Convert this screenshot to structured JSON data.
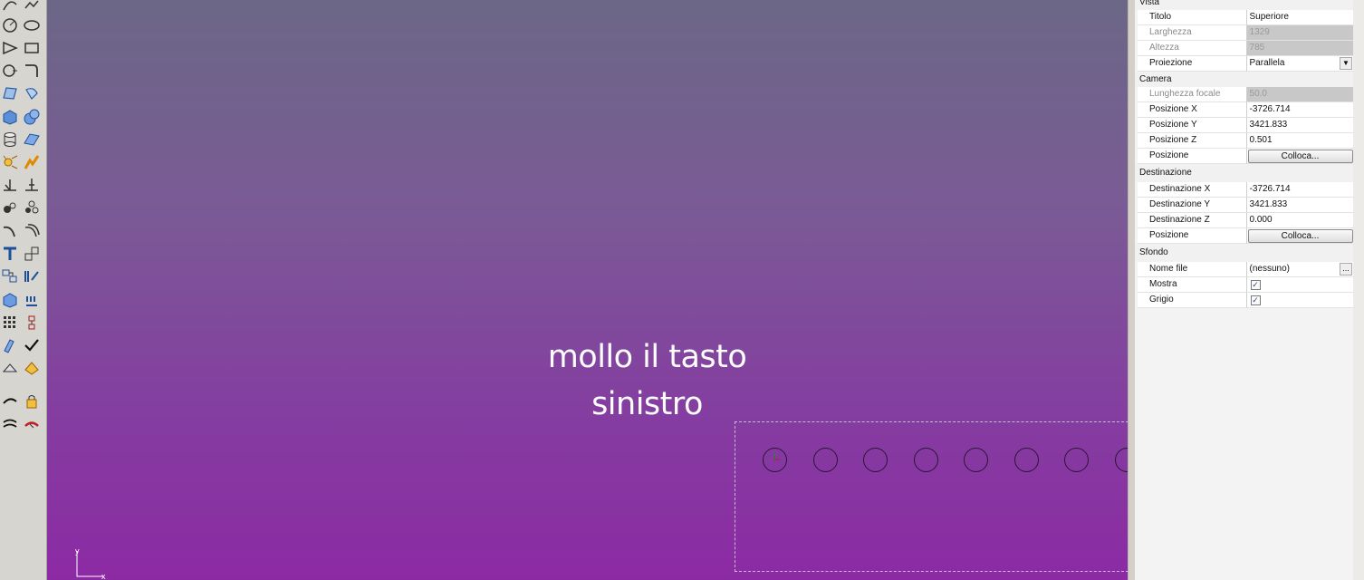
{
  "caption": {
    "line1": "mollo il tasto",
    "line2": "sinistro"
  },
  "axis": {
    "x": "x",
    "y": "y"
  },
  "properties": {
    "vista": {
      "label": "Vista",
      "titolo": {
        "key": "Titolo",
        "value": "Superiore"
      },
      "larghezza": {
        "key": "Larghezza",
        "value": "1329"
      },
      "altezza": {
        "key": "Altezza",
        "value": "785"
      },
      "proiezione": {
        "key": "Proiezione",
        "value": "Parallela"
      }
    },
    "camera": {
      "label": "Camera",
      "focale": {
        "key": "Lunghezza focale",
        "value": "50.0"
      },
      "pos_x": {
        "key": "Posizione X",
        "value": "-3726.714"
      },
      "pos_y": {
        "key": "Posizione Y",
        "value": "3421.833"
      },
      "pos_z": {
        "key": "Posizione Z",
        "value": "0.501"
      },
      "posizione": {
        "key": "Posizione",
        "button": "Colloca..."
      }
    },
    "destinazione": {
      "label": "Destinazione",
      "dest_x": {
        "key": "Destinazione X",
        "value": "-3726.714"
      },
      "dest_y": {
        "key": "Destinazione Y",
        "value": "3421.833"
      },
      "dest_z": {
        "key": "Destinazione Z",
        "value": "0.000"
      },
      "posizione": {
        "key": "Posizione",
        "button": "Colloca..."
      }
    },
    "sfondo": {
      "label": "Sfondo",
      "nome_file": {
        "key": "Nome file",
        "value": "(nessuno)",
        "button": "..."
      },
      "mostra": {
        "key": "Mostra",
        "checked": "✓"
      },
      "grigio": {
        "key": "Grigio",
        "checked": "✓"
      }
    }
  },
  "toolbar_icons": [
    "arc-icon",
    "circle-icon",
    "polygon-icon",
    "rectangle-icon",
    "curve-icon",
    "fillet-icon",
    "surface-icon",
    "revolve-icon",
    "box-icon",
    "sphere-icon",
    "cylinder-icon",
    "plane-icon",
    "explode-icon",
    "boolean-icon",
    "dimension-icon",
    "array-icon",
    "transform-icon",
    "scale-icon",
    "text-icon",
    "mirror-icon",
    "group-icon",
    "edit-icon",
    "mesh-icon",
    "render-icon",
    "grid-icon",
    "snap-icon",
    "analyze-icon",
    "check-icon",
    "light-icon",
    "material-icon",
    "undo-icon",
    "lock-icon",
    "layer-icon",
    "hide-icon"
  ]
}
